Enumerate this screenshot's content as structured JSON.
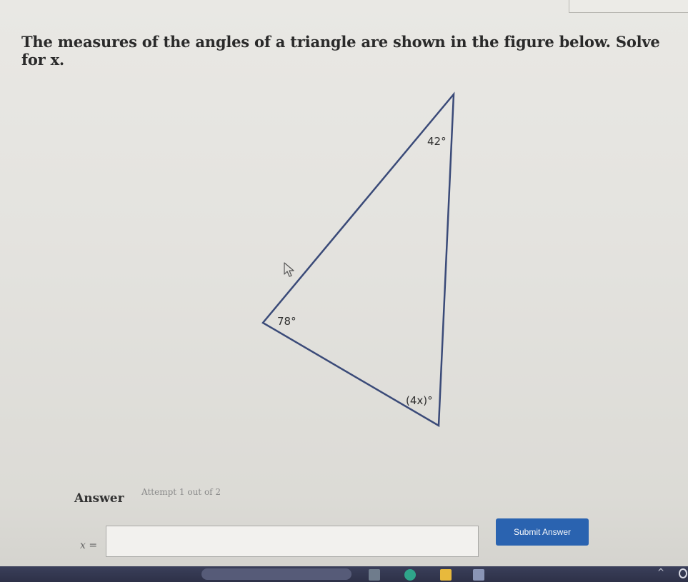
{
  "question": {
    "text": "The measures of the angles of a triangle are shown in the figure below. Solve for x."
  },
  "figure": {
    "angles": {
      "top": "42°",
      "left": "78°",
      "bottom": "(4x)°"
    }
  },
  "answer": {
    "heading": "Answer",
    "attempt": "Attempt 1 out of 2",
    "variable_label": "x =",
    "input_value": "",
    "submit_label": "Submit Answer"
  },
  "colors": {
    "submit_button": "#2a63b0",
    "taskbar": "#33374f"
  },
  "taskbar": {
    "icons": [
      "search-box",
      "app-icon",
      "edge-icon",
      "file-explorer-icon",
      "store-icon"
    ]
  }
}
